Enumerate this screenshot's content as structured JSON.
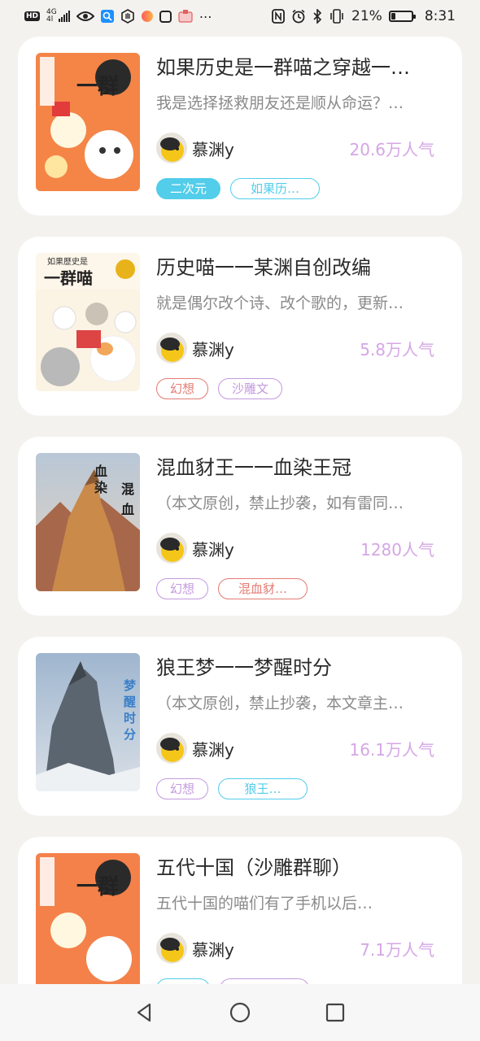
{
  "status_bar": {
    "hd": "HD",
    "network_top": "4G",
    "network_bottom": "4l",
    "battery_percent": "21%",
    "battery_level": 0.21,
    "time": "8:31",
    "icons": [
      "eye-icon",
      "search-app-icon",
      "hand-icon",
      "color-app-icon",
      "shield-app-icon",
      "notification-app-icon",
      "more-icon",
      "nfc-icon",
      "alarm-icon",
      "bluetooth-icon",
      "vibrate-icon",
      "battery-icon"
    ]
  },
  "books": [
    {
      "title": "如果历史是一群喵之穿越一…",
      "description": "我是选择拯救朋友还是顺从命运？…",
      "author": "慕渊y",
      "popularity": "20.6万人气",
      "cover_text": "如果历史是一群喵",
      "tags": [
        {
          "label": "二次元",
          "style": "filled-cyan"
        },
        {
          "label": "如果历…",
          "style": "cyan"
        }
      ]
    },
    {
      "title": "历史喵一一某渊自创改编",
      "description": "就是偶尔改个诗、改个歌的，更新…",
      "author": "慕渊y",
      "popularity": "5.8万人气",
      "cover_text": "如果历史是一群喵",
      "tags": [
        {
          "label": "幻想",
          "style": "red"
        },
        {
          "label": "沙雕文",
          "style": "purple"
        }
      ]
    },
    {
      "title": "混血豺王一一血染王冠",
      "description": "（本文原创，禁止抄袭，如有雷同…",
      "author": "慕渊y",
      "popularity": "1280人气",
      "cover_text": "血染王冠 混血豺王",
      "tags": [
        {
          "label": "幻想",
          "style": "purple"
        },
        {
          "label": "混血豺…",
          "style": "red"
        }
      ]
    },
    {
      "title": "狼王梦一一梦醒时分",
      "description": "（本文原创，禁止抄袭，本文章主…",
      "author": "慕渊y",
      "popularity": "16.1万人气",
      "cover_text": "梦醒时分 狼王梦",
      "tags": [
        {
          "label": "幻想",
          "style": "purple"
        },
        {
          "label": "狼王…",
          "style": "cyan"
        }
      ]
    },
    {
      "title": "五代十国（沙雕群聊）",
      "description": "五代十国的喵们有了手机以后…",
      "author": "慕渊y",
      "popularity": "7.1万人气",
      "cover_text": "如果历史是一群喵",
      "tags": [
        {
          "label": "",
          "style": "cyan"
        },
        {
          "label": "",
          "style": "purple"
        }
      ]
    }
  ],
  "nav_bar": {
    "icons": [
      "back-icon",
      "home-icon",
      "recents-icon"
    ]
  }
}
